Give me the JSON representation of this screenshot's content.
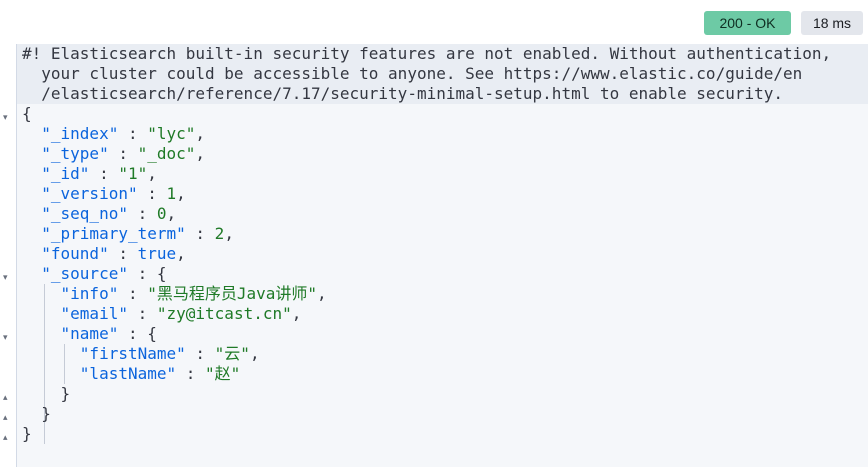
{
  "status": {
    "code_text": "200 - OK",
    "time_text": "18 ms",
    "ok_color": "#6dcaa5"
  },
  "warning": {
    "line1": "#! Elasticsearch built-in security features are not enabled. Without authentication,",
    "line2": "  your cluster could be accessible to anyone. See https://www.elastic.co/guide/en",
    "line3": "  /elasticsearch/reference/7.17/security-minimal-setup.html to enable security."
  },
  "response": {
    "open_brace": "{",
    "close_brace": "}",
    "index_key": "\"_index\"",
    "index_value": "\"lyc\"",
    "type_key": "\"_type\"",
    "type_value": "\"_doc\"",
    "id_key": "\"_id\"",
    "id_value": "\"1\"",
    "version_key": "\"_version\"",
    "version_value": "1",
    "seq_no_key": "\"_seq_no\"",
    "seq_no_value": "0",
    "primary_term_key": "\"_primary_term\"",
    "primary_term_value": "2",
    "found_key": "\"found\"",
    "found_value": "true",
    "source_key": "\"_source\"",
    "source": {
      "info_key": "\"info\"",
      "info_value": "\"黑马程序员Java讲师\"",
      "email_key": "\"email\"",
      "email_value": "\"zy@itcast.cn\"",
      "name_key": "\"name\"",
      "name": {
        "first_key": "\"firstName\"",
        "first_value": "\"云\"",
        "last_key": "\"lastName\"",
        "last_value": "\"赵\""
      }
    }
  },
  "icons": {
    "fold_open": "▾",
    "fold_end": "▴"
  }
}
